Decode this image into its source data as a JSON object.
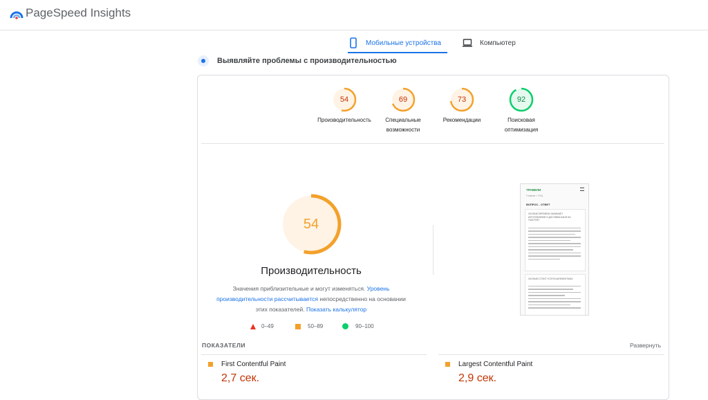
{
  "app": {
    "title": "PageSpeed Insights"
  },
  "tabs": [
    {
      "label": "Мобильные устройства",
      "active": true
    },
    {
      "label": "Компьютер",
      "active": false
    }
  ],
  "section": {
    "heading": "Выявляйте проблемы с производительностью"
  },
  "categories": [
    {
      "score": "54",
      "label_lines": [
        "Производительность"
      ],
      "color": "#f3a12b"
    },
    {
      "score": "69",
      "label_lines": [
        "Специальные",
        "возможности"
      ],
      "color": "#f3a12b"
    },
    {
      "score": "73",
      "label_lines": [
        "Рекомендации"
      ],
      "color": "#f3a12b"
    },
    {
      "score": "92",
      "label_lines": [
        "Поисковая",
        "оптимизация"
      ],
      "color": "#0cce6b"
    }
  ],
  "performance": {
    "score": "54",
    "title": "Производительность",
    "desc_prefix": "Значения приблизительные и могут изменяться.",
    "desc_link1": "Уровень производительности рассчитывается",
    "desc_middle": "непосредственно на основании этих показателей.",
    "desc_link2": "Показать калькулятор"
  },
  "legend": {
    "fail": "0–49",
    "average": "50–89",
    "pass": "90–100"
  },
  "screenshot": {
    "brand": "ТРАВЕЛИ",
    "crumb": "Главная > FAQ",
    "heading": "ВОПРОС - ОТВЕТ",
    "q1": "СКОЛЬКО ВРЕМЕНИ ЗАНИМАЕТ ИЗГОТОВЛЕНИЕ И ДОСТАВКА БАНИ НА УЧАСТОК?",
    "q2": "СКОЛЬКО СТОИТ УСЛУГА ШЕФМОНТАЖА"
  },
  "indicators": {
    "heading": "ПОКАЗАТЕЛИ",
    "expand": "Развернуть",
    "items": [
      {
        "name": "First Contentful Paint",
        "value": "2,7 сек."
      },
      {
        "name": "Largest Contentful Paint",
        "value": "2,9 сек."
      }
    ]
  },
  "colors": {
    "accent": "#1a73e8",
    "average": "#f3a12b",
    "pass": "#0cce6b",
    "fail": "#ea3323",
    "metric_value": "#c33300"
  }
}
